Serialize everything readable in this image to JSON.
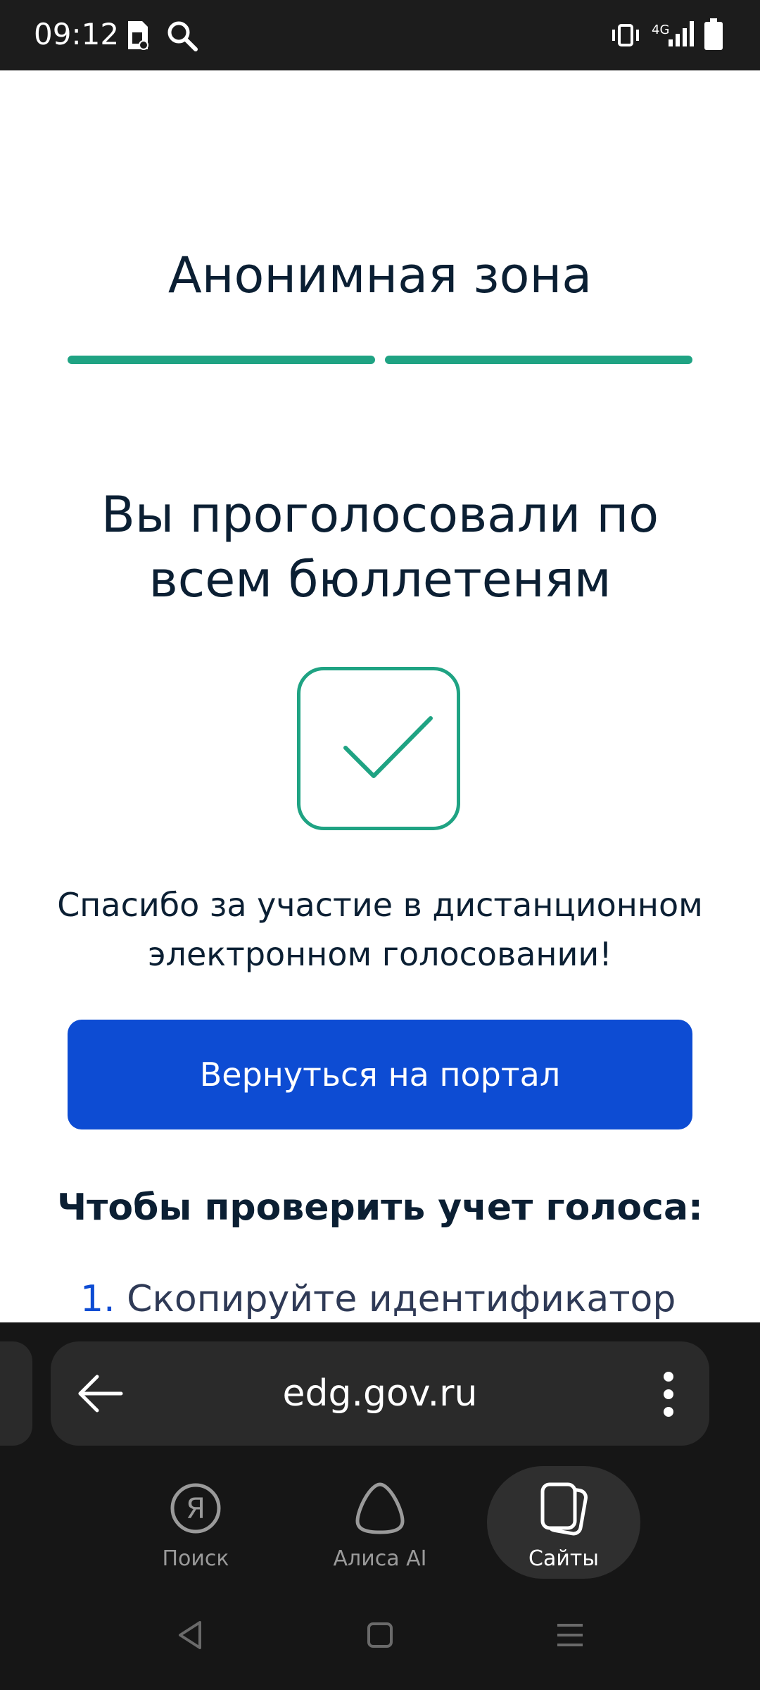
{
  "status_bar": {
    "time": "09:12",
    "network": "4G"
  },
  "page": {
    "zone_title": "Анонимная зона",
    "headline_line1": "Вы проголосовали по",
    "headline_line2": "всем бюллетеням",
    "thanks_line1": "Спасибо за участие в дистанционном",
    "thanks_line2": "электронном голосовании!",
    "portal_button": "Вернуться на портал",
    "verify_title": "Чтобы проверить учет голоса:",
    "step1_number": "1.",
    "step1_text": "Скопируйте идентификатор"
  },
  "browser": {
    "url": "edg.gov.ru",
    "nav": [
      {
        "label": "Поиск",
        "icon": "yandex-search-icon"
      },
      {
        "label": "Алиса AI",
        "icon": "alice-icon"
      },
      {
        "label": "Сайты",
        "icon": "tabs-icon"
      }
    ]
  },
  "colors": {
    "accent_green": "#1fa383",
    "button_blue": "#0d4cd3",
    "text_dark": "#0b1f33"
  }
}
